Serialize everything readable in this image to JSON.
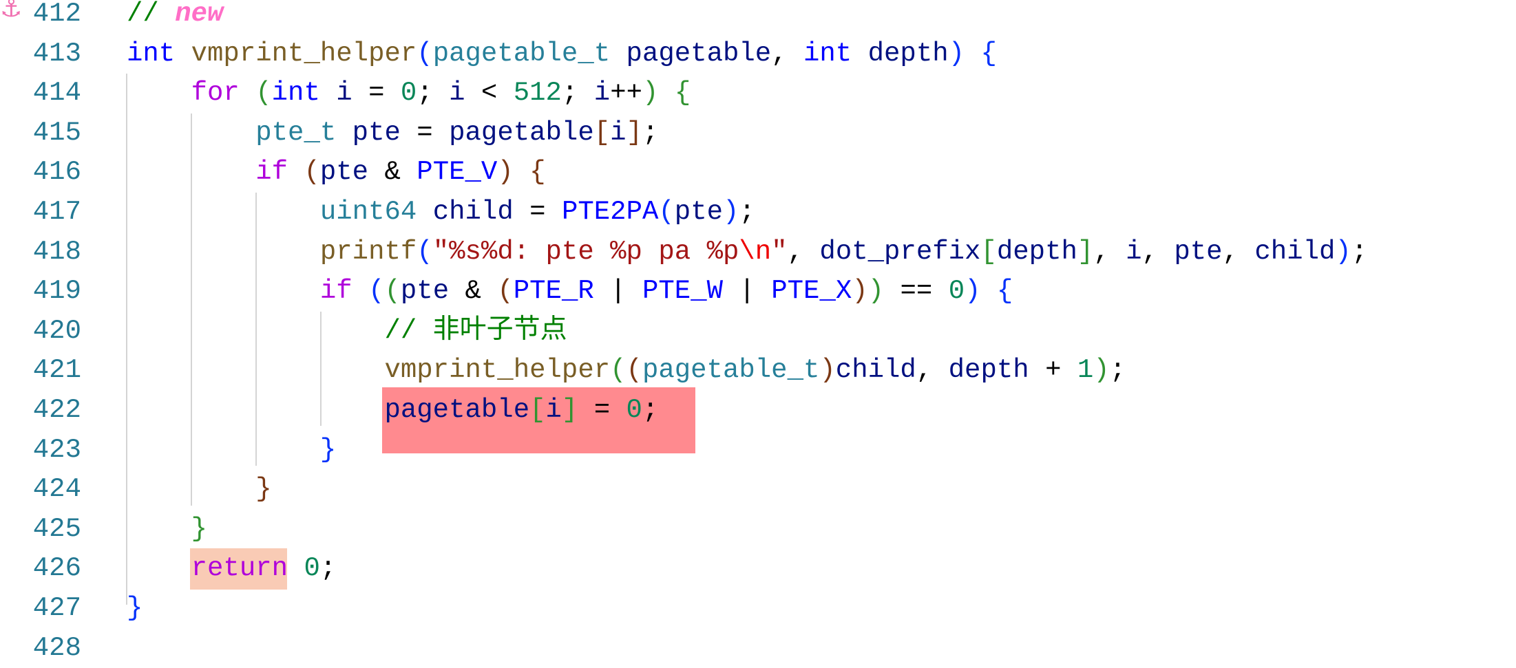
{
  "editor": {
    "bookmark_icon": "anchor-icon",
    "highlight_colors": {
      "error": "#ff8a8f",
      "match": "#f9cbb5"
    },
    "lines": [
      {
        "number": "412",
        "indent": 0,
        "tokens": [
          [
            "// ",
            "com"
          ],
          [
            "new",
            "tag"
          ]
        ]
      },
      {
        "number": "413",
        "indent": 0,
        "tokens": [
          [
            "int",
            "kw"
          ],
          [
            " ",
            "op"
          ],
          [
            "vmprint_helper",
            "fn"
          ],
          [
            "(",
            "b1"
          ],
          [
            "pagetable_t",
            "ty"
          ],
          [
            " ",
            "op"
          ],
          [
            "pagetable",
            "var"
          ],
          [
            ", ",
            "op"
          ],
          [
            "int",
            "kw"
          ],
          [
            " ",
            "op"
          ],
          [
            "depth",
            "var"
          ],
          [
            ")",
            "b1"
          ],
          [
            " ",
            "op"
          ],
          [
            "{",
            "b1"
          ]
        ]
      },
      {
        "number": "414",
        "indent": 1,
        "tokens": [
          [
            "for",
            "ctl"
          ],
          [
            " ",
            "op"
          ],
          [
            "(",
            "b2"
          ],
          [
            "int",
            "kw"
          ],
          [
            " ",
            "op"
          ],
          [
            "i",
            "var"
          ],
          [
            " = ",
            "op"
          ],
          [
            "0",
            "num"
          ],
          [
            "; ",
            "op"
          ],
          [
            "i",
            "var"
          ],
          [
            " < ",
            "op"
          ],
          [
            "512",
            "num"
          ],
          [
            "; ",
            "op"
          ],
          [
            "i",
            "var"
          ],
          [
            "++",
            "op"
          ],
          [
            ")",
            "b2"
          ],
          [
            " ",
            "op"
          ],
          [
            "{",
            "b2"
          ]
        ]
      },
      {
        "number": "415",
        "indent": 2,
        "tokens": [
          [
            "pte_t",
            "ty"
          ],
          [
            " ",
            "op"
          ],
          [
            "pte",
            "var"
          ],
          [
            " = ",
            "op"
          ],
          [
            "pagetable",
            "var"
          ],
          [
            "[",
            "b3"
          ],
          [
            "i",
            "var"
          ],
          [
            "]",
            "b3"
          ],
          [
            ";",
            "op"
          ]
        ]
      },
      {
        "number": "416",
        "indent": 2,
        "tokens": [
          [
            "if",
            "ctl"
          ],
          [
            " ",
            "op"
          ],
          [
            "(",
            "b3"
          ],
          [
            "pte",
            "var"
          ],
          [
            " & ",
            "op"
          ],
          [
            "PTE_V",
            "mac"
          ],
          [
            ")",
            "b3"
          ],
          [
            " ",
            "op"
          ],
          [
            "{",
            "b3"
          ]
        ]
      },
      {
        "number": "417",
        "indent": 3,
        "tokens": [
          [
            "uint64",
            "ty"
          ],
          [
            " ",
            "op"
          ],
          [
            "child",
            "var"
          ],
          [
            " = ",
            "op"
          ],
          [
            "PTE2PA",
            "mac"
          ],
          [
            "(",
            "b1"
          ],
          [
            "pte",
            "var"
          ],
          [
            ")",
            "b1"
          ],
          [
            ";",
            "op"
          ]
        ]
      },
      {
        "number": "418",
        "indent": 3,
        "tokens": [
          [
            "printf",
            "fn"
          ],
          [
            "(",
            "b1"
          ],
          [
            "\"%s%d: pte %p pa %p",
            "str"
          ],
          [
            "\\n",
            "esc"
          ],
          [
            "\"",
            "str"
          ],
          [
            ", ",
            "op"
          ],
          [
            "dot_prefix",
            "var"
          ],
          [
            "[",
            "b2"
          ],
          [
            "depth",
            "var"
          ],
          [
            "]",
            "b2"
          ],
          [
            ", ",
            "op"
          ],
          [
            "i",
            "var"
          ],
          [
            ", ",
            "op"
          ],
          [
            "pte",
            "var"
          ],
          [
            ", ",
            "op"
          ],
          [
            "child",
            "var"
          ],
          [
            ")",
            "b1"
          ],
          [
            ";",
            "op"
          ]
        ]
      },
      {
        "number": "419",
        "indent": 3,
        "tokens": [
          [
            "if",
            "ctl"
          ],
          [
            " ",
            "op"
          ],
          [
            "(",
            "b1"
          ],
          [
            "(",
            "b2"
          ],
          [
            "pte",
            "var"
          ],
          [
            " & ",
            "op"
          ],
          [
            "(",
            "b3"
          ],
          [
            "PTE_R",
            "mac"
          ],
          [
            " | ",
            "op"
          ],
          [
            "PTE_W",
            "mac"
          ],
          [
            " | ",
            "op"
          ],
          [
            "PTE_X",
            "mac"
          ],
          [
            ")",
            "b3"
          ],
          [
            ")",
            "b2"
          ],
          [
            " == ",
            "op"
          ],
          [
            "0",
            "num"
          ],
          [
            ")",
            "b1"
          ],
          [
            " ",
            "op"
          ],
          [
            "{",
            "b1"
          ]
        ]
      },
      {
        "number": "420",
        "indent": 4,
        "tokens": [
          [
            "// 非叶子节点",
            "com"
          ]
        ]
      },
      {
        "number": "421",
        "indent": 4,
        "tokens": [
          [
            "vmprint_helper",
            "fn"
          ],
          [
            "(",
            "b2"
          ],
          [
            "(",
            "b3"
          ],
          [
            "pagetable_t",
            "ty"
          ],
          [
            ")",
            "b3"
          ],
          [
            "child",
            "var"
          ],
          [
            ", ",
            "op"
          ],
          [
            "depth",
            "var"
          ],
          [
            " + ",
            "op"
          ],
          [
            "1",
            "num"
          ],
          [
            ")",
            "b2"
          ],
          [
            ";",
            "op"
          ]
        ]
      },
      {
        "number": "422",
        "indent": 4,
        "tokens": [
          [
            "pagetable",
            "var"
          ],
          [
            "[",
            "b2"
          ],
          [
            "i",
            "var"
          ],
          [
            "]",
            "b2"
          ],
          [
            " = ",
            "op"
          ],
          [
            "0",
            "num"
          ],
          [
            ";",
            "op"
          ]
        ]
      },
      {
        "number": "423",
        "indent": 3,
        "tokens": [
          [
            "}",
            "b1"
          ]
        ]
      },
      {
        "number": "424",
        "indent": 2,
        "tokens": [
          [
            "}",
            "b3"
          ]
        ]
      },
      {
        "number": "425",
        "indent": 1,
        "tokens": [
          [
            "}",
            "b2"
          ]
        ]
      },
      {
        "number": "426",
        "indent": 1,
        "tokens": [
          [
            "return",
            "ctl"
          ],
          [
            " ",
            "op"
          ],
          [
            "0",
            "num"
          ],
          [
            ";",
            "op"
          ]
        ]
      },
      {
        "number": "427",
        "indent": 0,
        "tokens": [
          [
            "}",
            "b1"
          ]
        ]
      },
      {
        "number": "428",
        "indent": 0,
        "tokens": []
      }
    ]
  }
}
